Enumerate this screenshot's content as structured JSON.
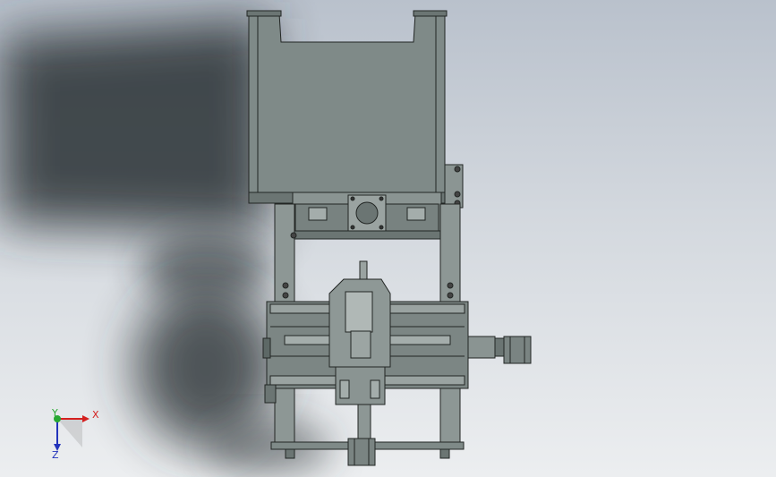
{
  "viewport": {
    "background_top": "#b9c1cc",
    "background_bottom": "#eceef0",
    "shadow_color": "#2b3035",
    "part_fill": "#7f8a88",
    "part_dark": "#5d6866",
    "part_light": "#a4adab",
    "edge_color": "#222624"
  },
  "triad": {
    "x_label": "X",
    "y_label": "Y",
    "z_label": "Z",
    "x_color": "#d42020",
    "y_color": "#27a832",
    "z_color": "#2233bb"
  }
}
